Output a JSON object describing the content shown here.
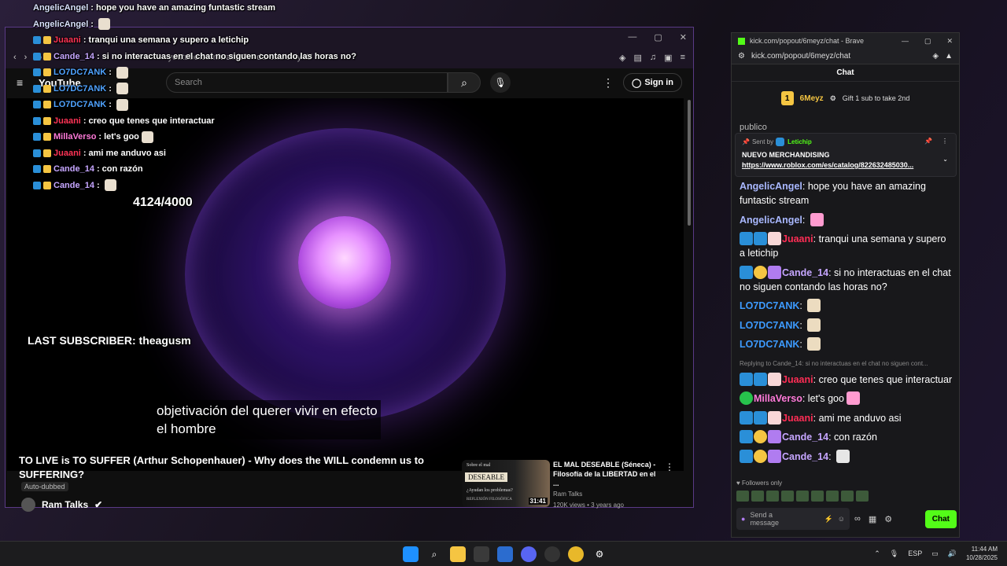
{
  "youtube": {
    "url": "youtube.com/watch?v=da-exUUNy4U",
    "logo": "YouTube",
    "search_placeholder": "Search",
    "sign_in": "Sign in",
    "counter": "4124/4000",
    "last_subscriber": "LAST SUBSCRIBER: theagusm",
    "subtitle_line1": "objetivación del querer vivir en efecto",
    "subtitle_line2": "el hombre",
    "video_title": "TO LIVE is TO SUFFER (Arthur Schopenhauer) - Why does the WILL condemn us to SUFFERING?",
    "auto_dubbed": "Auto-dubbed",
    "channel": "Ram Talks",
    "recommended": {
      "thumb_line1": "Sobre el mal",
      "thumb_label": "DESEABLE",
      "thumb_line2": "¿Ayudan los problemas?",
      "thumb_line3": "REFLEXIÓN FILOSÓFICA",
      "duration": "31:41",
      "title": "EL MAL DESEABLE (Séneca) - Filosofía de la LIBERTAD en el ...",
      "channel": "Ram Talks",
      "meta": "120K views • 3 years ago"
    }
  },
  "overlay_chat": [
    {
      "user": "AngelicAngel",
      "text": "hope you have an amazing funtastic stream",
      "color": "#dbe3ff"
    },
    {
      "user": "AngelicAngel",
      "text": "",
      "color": "#dbe3ff",
      "emote": true
    },
    {
      "user": "Juaani",
      "text": "tranqui una semana y supero a letichip",
      "color": "#ff3355"
    },
    {
      "user": "Cande_14",
      "text": "si no interactuas en el chat no siguen contando las horas no?",
      "color": "#c6a6ff"
    },
    {
      "user": "LO7DC7ANK",
      "text": "",
      "color": "#4fa3ff",
      "emote": true
    },
    {
      "user": "LO7DC7ANK",
      "text": "",
      "color": "#4fa3ff",
      "emote": true
    },
    {
      "user": "LO7DC7ANK",
      "text": "",
      "color": "#4fa3ff",
      "emote": true
    },
    {
      "user": "Juaani",
      "text": "creo que tenes que interactuar",
      "color": "#ff3355"
    },
    {
      "user": "MillaVerso",
      "text": "let's goo",
      "color": "#ff7ad9",
      "emote": true
    },
    {
      "user": "Juaani",
      "text": "ami me anduvo asi",
      "color": "#ff3355"
    },
    {
      "user": "Cande_14",
      "text": "con razón",
      "color": "#c6a6ff"
    },
    {
      "user": "Cande_14",
      "text": "",
      "color": "#c6a6ff",
      "emote": true
    }
  ],
  "kick": {
    "window_title": "kick.com/popout/6meyz/chat - Brave",
    "url": "kick.com/popout/6meyz/chat",
    "header": "Chat",
    "gift_user": "6Meyz",
    "gift_count": "1",
    "gift_cta": "Gift 1 sub to take 2nd",
    "partial_text": "publico",
    "pinned_sent_by": "Sent by",
    "pinned_user": "Letichip",
    "pinned_title": "NUEVO MERCHANDISING",
    "pinned_link": "https://www.roblox.com/es/catalog/822632485030...",
    "reply_text": "Replying to Cande_14: si no interactuas en el chat no siguen cont...",
    "followers_only": "Followers only",
    "input_placeholder": "Send a message",
    "chat_button": "Chat",
    "messages": [
      {
        "user": "AngelicAngel",
        "color": "#a9b8ff",
        "text": "hope you have an amazing funtastic stream",
        "badges": []
      },
      {
        "user": "AngelicAngel",
        "color": "#a9b8ff",
        "text": "",
        "badges": [],
        "emote": "kb-pink"
      },
      {
        "user": "Juaani",
        "color": "#ff2d55",
        "text": "tranqui una semana y supero a letichip",
        "badges": [
          "kb-blue",
          "kb-blue",
          "kb-red"
        ]
      },
      {
        "user": "Cande_14",
        "color": "#c6a6ff",
        "text": "si no interactuas en el chat no siguen contando las horas no?",
        "badges": [
          "kb-blue",
          "kb-gold",
          "kb-gift"
        ]
      },
      {
        "user": "LO7DC7ANK",
        "color": "#3d9bff",
        "text": "",
        "badges": [],
        "emote": "kb-emote"
      },
      {
        "user": "LO7DC7ANK",
        "color": "#3d9bff",
        "text": "",
        "badges": [],
        "emote": "kb-emote"
      },
      {
        "user": "LO7DC7ANK",
        "color": "#3d9bff",
        "text": "",
        "badges": [],
        "emote": "kb-emote"
      },
      {
        "user": "Juaani",
        "color": "#ff2d55",
        "text": "creo que tenes que interactuar",
        "badges": [
          "kb-blue",
          "kb-blue",
          "kb-red"
        ],
        "reply": true
      },
      {
        "user": "MillaVerso",
        "color": "#ff7ad9",
        "text": "let's goo",
        "badges": [
          "kb-green"
        ],
        "emote": "kb-pink"
      },
      {
        "user": "Juaani",
        "color": "#ff2d55",
        "text": "ami me anduvo asi",
        "badges": [
          "kb-blue",
          "kb-blue",
          "kb-red"
        ]
      },
      {
        "user": "Cande_14",
        "color": "#c6a6ff",
        "text": "con razón",
        "badges": [
          "kb-blue",
          "kb-gold",
          "kb-gift"
        ]
      },
      {
        "user": "Cande_14",
        "color": "#c6a6ff",
        "text": "",
        "badges": [
          "kb-blue",
          "kb-gold",
          "kb-gift"
        ],
        "emote": "kb-sub"
      }
    ]
  },
  "taskbar": {
    "lang": "ESP",
    "time": "11:44 AM",
    "date": "10/28/2025"
  }
}
